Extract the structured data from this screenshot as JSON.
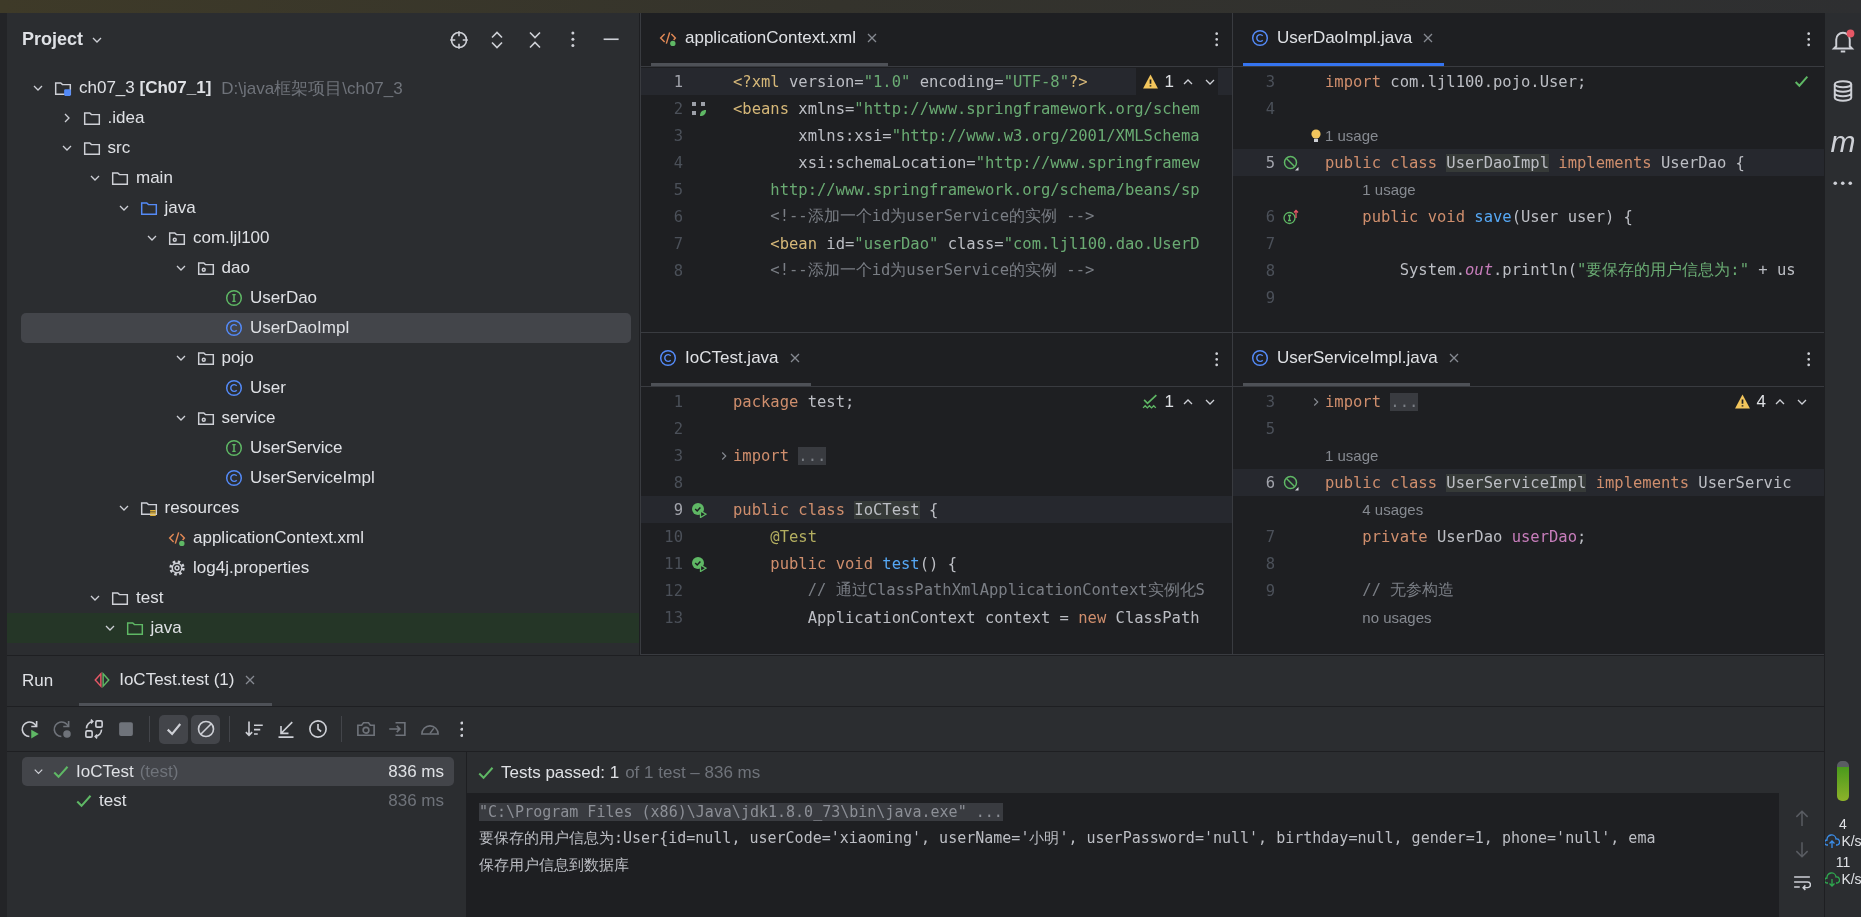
{
  "project_panel": {
    "title": "Project",
    "actions": [
      {
        "kind": "locate"
      },
      {
        "kind": "expand-all"
      },
      {
        "kind": "collapse-all"
      },
      {
        "kind": "options"
      },
      {
        "kind": "hide"
      }
    ],
    "tree": [
      {
        "label": "ch07_3 **[Ch07_1]**",
        "path": "D:\\java框架项目\\ch07_3",
        "kind": "module",
        "expanded": true,
        "selected": false,
        "children": [
          {
            "label": ".idea",
            "kind": "folder",
            "expanded": false,
            "selected": false
          },
          {
            "label": "src",
            "kind": "folder",
            "expanded": true,
            "selected": false,
            "children": [
              {
                "label": "main",
                "kind": "folder",
                "expanded": true,
                "selected": false,
                "children": [
                  {
                    "label": "java",
                    "kind": "source-folder",
                    "expanded": true,
                    "selected": false,
                    "children": [
                      {
                        "label": "com.ljl100",
                        "kind": "package",
                        "expanded": true,
                        "selected": false,
                        "children": [
                          {
                            "label": "dao",
                            "kind": "package",
                            "expanded": true,
                            "selected": false,
                            "children": [
                              {
                                "label": "UserDao",
                                "kind": "interface",
                                "selected": false
                              },
                              {
                                "label": "UserDaoImpl",
                                "kind": "class",
                                "selected": true
                              }
                            ]
                          },
                          {
                            "label": "pojo",
                            "kind": "package",
                            "expanded": true,
                            "selected": false,
                            "children": [
                              {
                                "label": "User",
                                "kind": "class",
                                "selected": false
                              }
                            ]
                          },
                          {
                            "label": "service",
                            "kind": "package",
                            "expanded": true,
                            "selected": false,
                            "children": [
                              {
                                "label": "UserService",
                                "kind": "interface",
                                "selected": false
                              },
                              {
                                "label": "UserServiceImpl",
                                "kind": "class",
                                "selected": false
                              }
                            ]
                          }
                        ]
                      }
                    ]
                  },
                  {
                    "label": "resources",
                    "kind": "resources",
                    "expanded": true,
                    "selected": false,
                    "children": [
                      {
                        "label": "applicationContext.xml",
                        "kind": "xml",
                        "selected": false
                      },
                      {
                        "label": "log4j.properties",
                        "kind": "properties",
                        "selected": false
                      }
                    ]
                  }
                ]
              },
              {
                "label": "test",
                "kind": "folder",
                "expanded": true,
                "selected": false,
                "children": [
                  {
                    "label": "java",
                    "kind": "test-folder",
                    "expanded": true,
                    "selected": false,
                    "highlighted": true
                  }
                ]
              }
            ]
          }
        ]
      }
    ]
  },
  "editors": [
    {
      "tab": {
        "kind": "xml",
        "label": "applicationContext.xml",
        "selected": false
      },
      "inspection": {
        "kind": "warning",
        "count": "1"
      },
      "lines": [
        {
          "number": "1",
          "current": true,
          "tokens": [
            {
              "kind": "tag",
              "text": "<?xml "
            },
            {
              "kind": "attr",
              "text": "version="
            },
            {
              "kind": "str",
              "text": "\"1.0\""
            },
            {
              "kind": "attr",
              "text": " encoding="
            },
            {
              "kind": "str",
              "text": "\"UTF-8\""
            },
            {
              "kind": "tag",
              "text": "?>"
            }
          ]
        },
        {
          "number": "2",
          "gutter": {
            "kind": "bean"
          },
          "tokens": [
            {
              "kind": "tag",
              "text": "<beans "
            },
            {
              "kind": "attr",
              "text": "xmlns="
            },
            {
              "kind": "str",
              "text": "\"http://www.springframework.org/schem"
            }
          ]
        },
        {
          "number": "3",
          "tokens": [
            {
              "kind": "attr",
              "text": "       xmlns:xsi="
            },
            {
              "kind": "str",
              "text": "\"http://www.w3.org/2001/XMLSchema"
            }
          ]
        },
        {
          "number": "4",
          "tokens": [
            {
              "kind": "attr",
              "text": "       xsi:schemaLocation="
            },
            {
              "kind": "str",
              "text": "\"http://www.springframew"
            }
          ]
        },
        {
          "number": "5",
          "tokens": [
            {
              "kind": "str",
              "text": "    http://www.springframework.org/schema/beans/sp"
            }
          ]
        },
        {
          "number": "6",
          "tokens": [
            {
              "kind": "comment",
              "text": "    <!--添加一个id为userService的实例 -->"
            }
          ]
        },
        {
          "number": "7",
          "tokens": [
            {
              "kind": "tag",
              "text": "    <bean "
            },
            {
              "kind": "attr",
              "text": "id="
            },
            {
              "kind": "str",
              "text": "\"userDao\""
            },
            {
              "kind": "attr",
              "text": " class="
            },
            {
              "kind": "str",
              "text": "\"com.ljl100.dao.UserD"
            }
          ]
        },
        {
          "number": "8",
          "tokens": [
            {
              "kind": "comment",
              "text": "    <!--添加一个id为userService的实例 -->"
            }
          ]
        }
      ]
    },
    {
      "tab": {
        "kind": "class",
        "label": "UserDaoImpl.java",
        "selected": true
      },
      "inspection": {
        "kind": "ok"
      },
      "lines": [
        {
          "number": "3",
          "tokens": [
            {
              "kind": "kw",
              "text": "import "
            },
            {
              "kind": "plain",
              "text": "com.ljl100.pojo.User;"
            }
          ]
        },
        {
          "number": "4"
        },
        {
          "kind": "hint",
          "text": "1 usage",
          "marker": {
            "kind": "bulb"
          }
        },
        {
          "number": "5",
          "current": true,
          "gutter": {
            "kind": "implemented"
          },
          "tokens": [
            {
              "kind": "kw",
              "text": "public class "
            },
            {
              "kind": "decl",
              "text": "UserDaoImpl"
            },
            {
              "kind": "kw",
              "text": " implements "
            },
            {
              "kind": "plain",
              "text": "UserDao {"
            }
          ]
        },
        {
          "kind": "hint",
          "text": "    1 usage"
        },
        {
          "number": "6",
          "gutter": {
            "kind": "implements"
          },
          "tokens": [
            {
              "kind": "kw",
              "text": "    public void "
            },
            {
              "kind": "method",
              "text": "save"
            },
            {
              "kind": "plain",
              "text": "(User user) {"
            }
          ]
        },
        {
          "number": "7"
        },
        {
          "number": "8",
          "tokens": [
            {
              "kind": "plain",
              "text": "        System."
            },
            {
              "kind": "static",
              "text": "out"
            },
            {
              "kind": "plain",
              "text": ".println("
            },
            {
              "kind": "str",
              "text": "\"要保存的用户信息为:\""
            },
            {
              "kind": "plain",
              "text": " + us"
            }
          ]
        },
        {
          "number": "9"
        }
      ]
    },
    {
      "tab": {
        "kind": "class",
        "label": "IoCTest.java",
        "selected": false
      },
      "inspection": {
        "kind": "typo",
        "count": "1"
      },
      "lines": [
        {
          "number": "1",
          "tokens": [
            {
              "kind": "kw",
              "text": "package "
            },
            {
              "kind": "plain",
              "text": "test;"
            }
          ]
        },
        {
          "number": "2"
        },
        {
          "number": "3",
          "folded": true,
          "tokens": [
            {
              "kind": "kw",
              "text": "import "
            },
            {
              "kind": "folded",
              "text": "..."
            }
          ]
        },
        {
          "number": "8"
        },
        {
          "number": "9",
          "current": true,
          "gutter": {
            "kind": "run"
          },
          "tokens": [
            {
              "kind": "kw",
              "text": "public class "
            },
            {
              "kind": "decl",
              "text": "IoCTest"
            },
            {
              "kind": "plain",
              "text": " {"
            }
          ]
        },
        {
          "number": "10",
          "tokens": [
            {
              "kind": "annotation",
              "text": "    @Test"
            }
          ]
        },
        {
          "number": "11",
          "gutter": {
            "kind": "run"
          },
          "tokens": [
            {
              "kind": "kw",
              "text": "    public void "
            },
            {
              "kind": "method",
              "text": "test"
            },
            {
              "kind": "plain",
              "text": "() {"
            }
          ]
        },
        {
          "number": "12",
          "tokens": [
            {
              "kind": "comment",
              "text": "        // 通过ClassPathXmlApplicationContext实例化S"
            }
          ]
        },
        {
          "number": "13",
          "tokens": [
            {
              "kind": "plain",
              "text": "        ApplicationContext context = "
            },
            {
              "kind": "kw",
              "text": "new "
            },
            {
              "kind": "plain",
              "text": "ClassPath"
            }
          ]
        }
      ]
    },
    {
      "tab": {
        "kind": "class",
        "label": "UserServiceImpl.java",
        "selected": false
      },
      "inspection": {
        "kind": "warning",
        "count": "4"
      },
      "lines": [
        {
          "number": "3",
          "folded": true,
          "tokens": [
            {
              "kind": "kw",
              "text": "import "
            },
            {
              "kind": "folded",
              "text": "..."
            }
          ]
        },
        {
          "number": "5"
        },
        {
          "kind": "hint",
          "text": "1 usage"
        },
        {
          "number": "6",
          "current": true,
          "gutter": {
            "kind": "implemented"
          },
          "tokens": [
            {
              "kind": "kw",
              "text": "public class "
            },
            {
              "kind": "decl",
              "text": "UserServiceImpl"
            },
            {
              "kind": "kw",
              "text": " implements "
            },
            {
              "kind": "plain",
              "text": "UserServic"
            }
          ]
        },
        {
          "kind": "hint",
          "text": "    4 usages"
        },
        {
          "number": "7",
          "tokens": [
            {
              "kind": "kw",
              "text": "    private "
            },
            {
              "kind": "plain",
              "text": "UserDao "
            },
            {
              "kind": "field",
              "text": "userDao"
            },
            {
              "kind": "plain",
              "text": ";"
            }
          ]
        },
        {
          "number": "8"
        },
        {
          "number": "9",
          "tokens": [
            {
              "kind": "comment",
              "text": "    // 无参构造"
            }
          ]
        },
        {
          "kind": "hint",
          "text": "    no usages"
        }
      ]
    }
  ],
  "right_strip": {
    "tools": [
      {
        "kind": "notifications",
        "badge": true
      },
      {
        "kind": "database"
      },
      {
        "kind": "maven",
        "label": "m"
      },
      {
        "kind": "more"
      }
    ],
    "network": {
      "upload": "4",
      "upload_unit": "K/s",
      "download": "11",
      "download_unit": "K/s"
    }
  },
  "run_panel": {
    "title": "Run",
    "tabs": [
      {
        "label": "IoCTest.test (1)",
        "selected": true
      }
    ],
    "toolbar": [
      [
        {
          "kind": "rerun",
          "disabled": false,
          "selected": false
        },
        {
          "kind": "rerun-failed",
          "disabled": true,
          "selected": false
        },
        {
          "kind": "auto-test",
          "disabled": false,
          "selected": false
        },
        {
          "kind": "stop",
          "disabled": true,
          "selected": false
        }
      ],
      [
        {
          "kind": "show-passed",
          "disabled": false,
          "selected": true
        },
        {
          "kind": "show-ignored",
          "disabled": false,
          "selected": true
        }
      ],
      [
        {
          "kind": "sort",
          "disabled": false,
          "selected": false
        },
        {
          "kind": "collapse",
          "disabled": false,
          "selected": false
        },
        {
          "kind": "history",
          "disabled": false,
          "selected": false
        }
      ],
      [
        {
          "kind": "screenshot",
          "disabled": true,
          "selected": false
        },
        {
          "kind": "export",
          "disabled": true,
          "selected": false
        },
        {
          "kind": "profile",
          "disabled": true,
          "selected": false
        },
        {
          "kind": "more",
          "disabled": false,
          "selected": false
        }
      ]
    ],
    "results": [
      {
        "label": "IoCTest",
        "detail": "(test)",
        "time": "836 ms",
        "kind": "passed",
        "expanded": true,
        "selected": true,
        "children": [
          {
            "label": "test",
            "time": "836 ms",
            "kind": "passed",
            "selected": false
          }
        ]
      }
    ],
    "summary": {
      "kind": "passed",
      "headline": "Tests passed: 1",
      "detail": "of 1 test – 836 ms"
    },
    "console": [
      {
        "kind": "command",
        "text": "\"C:\\Program Files (x86)\\Java\\jdk1.8.0_73\\bin\\java.exe\" ..."
      },
      {
        "kind": "output",
        "text": "要保存的用户信息为:User{id=null, userCode='xiaoming', userName='小明', userPassword='null', birthday=null, gender=1, phone='null', ema"
      },
      {
        "kind": "output",
        "text": "保存用户信息到数据库"
      }
    ],
    "console_actions": [
      {
        "kind": "scroll-up",
        "disabled": true
      },
      {
        "kind": "scroll-down",
        "disabled": true
      },
      {
        "kind": "soft-wrap",
        "disabled": false
      }
    ]
  }
}
